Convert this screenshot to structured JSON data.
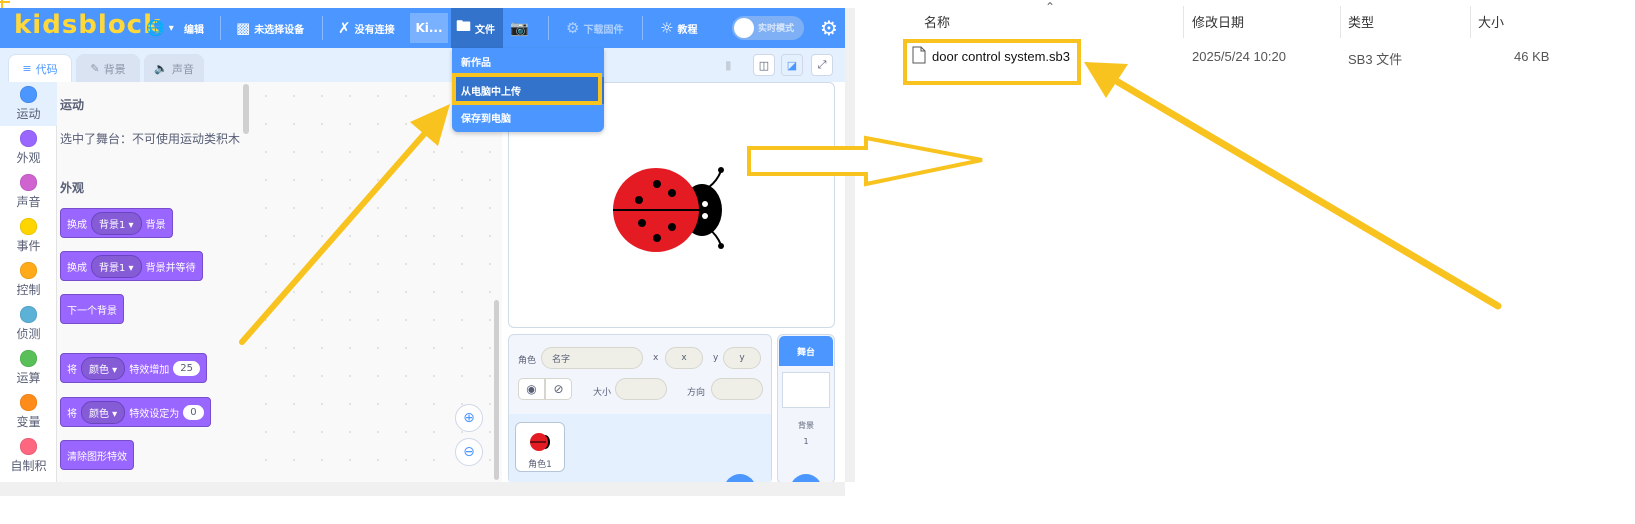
{
  "app": {
    "logo": "kidsblock",
    "menu": {
      "globe_label": "",
      "edit": "编辑",
      "device": "未选择设备",
      "connection": "没有连接",
      "project_short": "Ki...",
      "file": "文件",
      "download_firmware": "下载固件",
      "tutorial": "教程",
      "realtime_mode": "实时模式"
    },
    "file_menu": {
      "new": "新作品",
      "upload": "从电脑中上传",
      "save": "保存到电脑"
    },
    "tabs": {
      "code": "代码",
      "backdrops": "背景",
      "sounds": "声音"
    },
    "categories": [
      {
        "label": "运动",
        "color": "#4C97FF"
      },
      {
        "label": "外观",
        "color": "#9966FF"
      },
      {
        "label": "声音",
        "color": "#CF63CF"
      },
      {
        "label": "事件",
        "color": "#FFD500"
      },
      {
        "label": "控制",
        "color": "#FFAB19"
      },
      {
        "label": "侦测",
        "color": "#5CB1D6"
      },
      {
        "label": "运算",
        "color": "#59C059"
      },
      {
        "label": "变量",
        "color": "#FF8C1A"
      },
      {
        "label": "自制积",
        "color": "#FF6680"
      }
    ],
    "palette": {
      "motion_title": "运动",
      "motion_note": "选中了舞台：不可使用运动类积木",
      "looks_title": "外观",
      "blocks": [
        {
          "pre": "换成",
          "drop": "背景1",
          "post": "背景"
        },
        {
          "pre": "换成",
          "drop": "背景1",
          "post": "背景并等待"
        },
        {
          "pre": "下一个背景"
        },
        {
          "pre": "将",
          "drop": "颜色",
          "post": "特效增加",
          "num": "25"
        },
        {
          "pre": "将",
          "drop": "颜色",
          "post": "特效设定为",
          "num": "0"
        },
        {
          "pre": "清除图形特效"
        }
      ]
    },
    "sprite_info": {
      "sprite_label": "角色",
      "name_placeholder": "名字",
      "x_label": "x",
      "x_value": "x",
      "y_label": "y",
      "y_value": "y",
      "size_label": "大小",
      "direction_label": "方向"
    },
    "sprite_thumb_label": "角色1",
    "stage_pane": {
      "title": "舞台",
      "backdrop_label": "背景",
      "backdrop_count": "1"
    }
  },
  "explorer": {
    "headers": {
      "name": "名称",
      "modified": "修改日期",
      "type": "类型",
      "size": "大小"
    },
    "file": {
      "name": "door control system.sb3",
      "modified": "2025/5/24 10:20",
      "type": "SB3 文件",
      "size": "46 KB"
    }
  },
  "colors": {
    "highlight": "#F8C31F",
    "menu_bar": "#4C97FF",
    "looks_block": "#9966FF"
  }
}
